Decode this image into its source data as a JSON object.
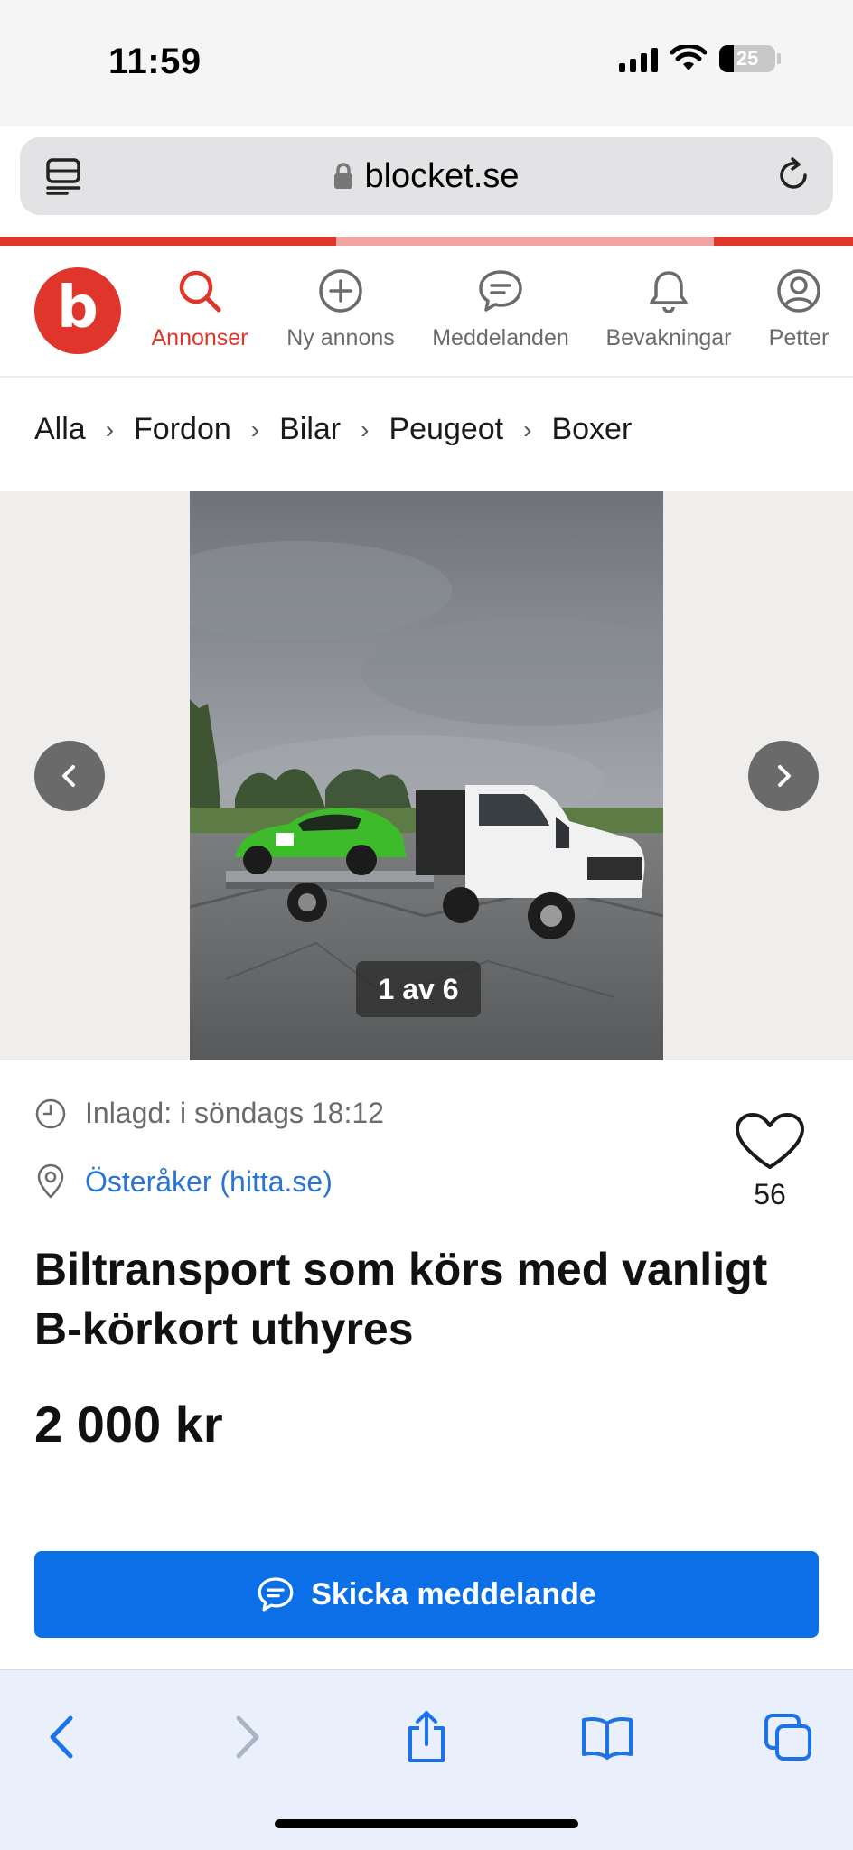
{
  "status_bar": {
    "time": "11:59",
    "battery": "25"
  },
  "browser": {
    "url": "blocket.se"
  },
  "nav": {
    "items": [
      {
        "label": "Annonser",
        "icon": "search-icon",
        "active": true
      },
      {
        "label": "Ny annons",
        "icon": "plus-circle-icon",
        "active": false
      },
      {
        "label": "Meddelanden",
        "icon": "chat-icon",
        "active": false
      },
      {
        "label": "Bevakningar",
        "icon": "bell-icon",
        "active": false
      },
      {
        "label": "Petter",
        "icon": "user-icon",
        "active": false
      }
    ]
  },
  "breadcrumb": [
    "Alla",
    "Fordon",
    "Bilar",
    "Peugeot",
    "Boxer"
  ],
  "gallery": {
    "counter": "1 av 6"
  },
  "listing": {
    "posted": "Inlagd: i söndags 18:12",
    "location": "Österåker (hitta.se)",
    "favorites": "56",
    "title": "Biltransport som körs med vanligt B-körkort uthyres",
    "price": "2 000 kr",
    "cta": "Skicka meddelande"
  },
  "colors": {
    "brand": "#e0352b",
    "link": "#2a74d6",
    "cta": "#0b6fe8"
  }
}
